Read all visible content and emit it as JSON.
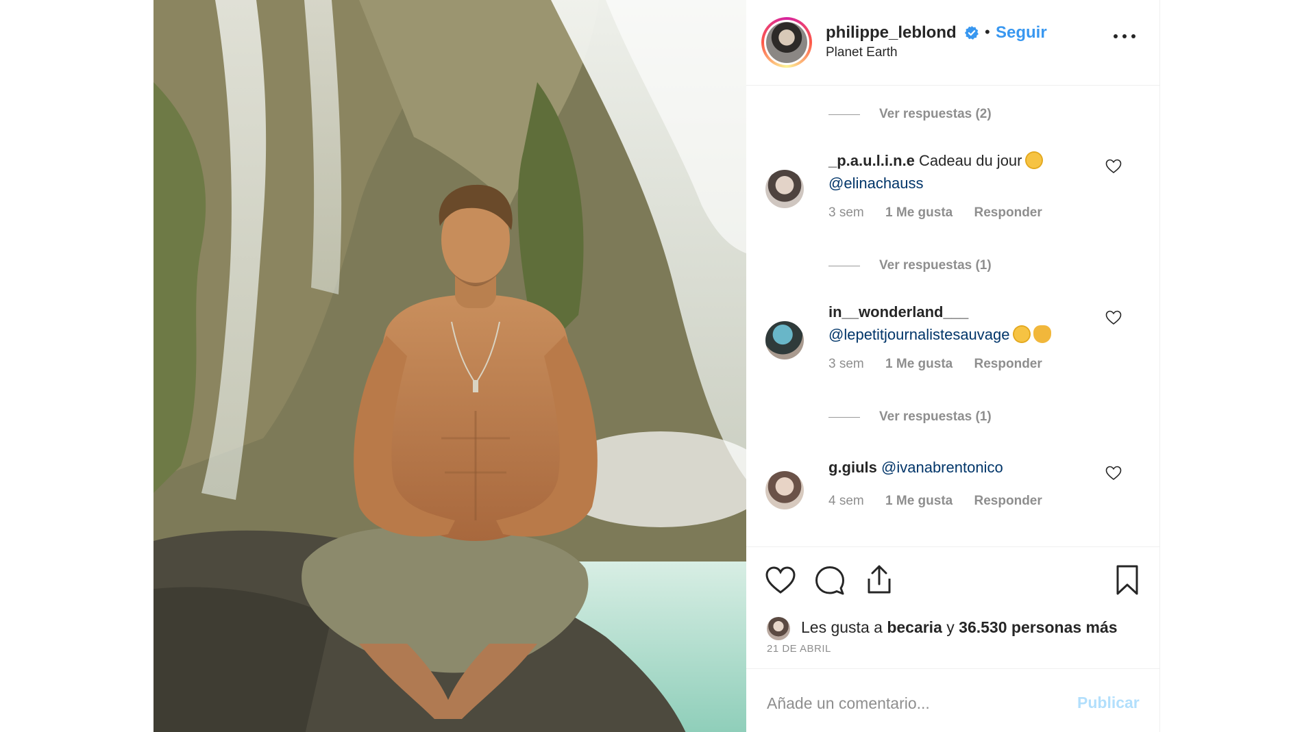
{
  "post": {
    "photo_description_icon": "meditation-waterfall-photo"
  },
  "header": {
    "username": "philippe_leblond",
    "separator": "•",
    "follow_label": "Seguir",
    "location": "Planet Earth"
  },
  "comments": {
    "view_replies_top": "Ver respuestas (2)",
    "items": [
      {
        "user": "_p.a.u.l.i.n.e",
        "text": "Cadeau du jour",
        "mention": "@elinachauss",
        "time": "3 sem",
        "likes": "1 Me gusta",
        "reply_label": "Responder",
        "view_replies": "Ver respuestas (1)"
      },
      {
        "user": "in__wonderland___",
        "text": "",
        "mention": "@lepetitjournalistesauvage",
        "time": "3 sem",
        "likes": "1 Me gusta",
        "reply_label": "Responder",
        "view_replies": "Ver respuestas (1)"
      },
      {
        "user": "g.giuls",
        "text": "",
        "mention": "@ivanabrentonico",
        "time": "4 sem",
        "likes": "1 Me gusta",
        "reply_label": "Responder"
      }
    ]
  },
  "actions": {
    "likes_prefix": "Les gusta a",
    "likes_user": "becaria",
    "likes_and": "y",
    "likes_count": "36.530 personas más",
    "date": "21 DE ABRIL"
  },
  "add_comment": {
    "placeholder": "Añade un comentario...",
    "publish_label": "Publicar"
  },
  "colors": {
    "accent": "#3897f0",
    "mention": "#003569",
    "muted": "#8e8e8e",
    "publish_disabled": "#b2dffc"
  }
}
